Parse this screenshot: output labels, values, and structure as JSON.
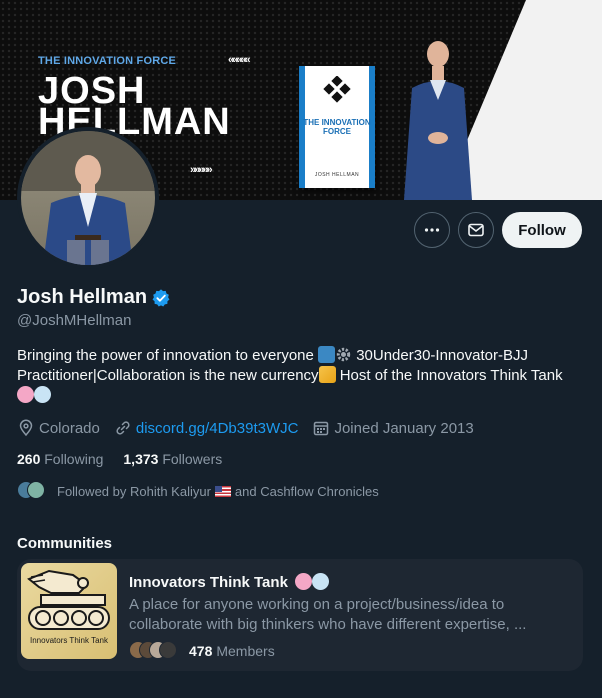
{
  "banner": {
    "kicker": "THE INNOVATION FORCE",
    "title_line1": "JOSH",
    "title_line2": "HELLMAN",
    "chevrons_top": "«««««",
    "chevrons_bottom": "»»»»»",
    "book_title": "THE INNOVATION FORCE",
    "book_author": "JOSH HELLMAN"
  },
  "actions": {
    "more_icon": "more-horizontal-icon",
    "message_icon": "envelope-icon",
    "follow_label": "Follow"
  },
  "profile": {
    "name": "Josh Hellman",
    "handle": "@JoshMHellman",
    "verified": true,
    "bio_part1": "Bringing the power of innovation to everyone ",
    "bio_part2": " 30Under30-Innovator-BJJ Practitioner|Collaboration is the new currency",
    "bio_part3": " Host of the Innovators Think Tank",
    "location": "Colorado",
    "website": "discord.gg/4Db39t3WJC",
    "joined": "Joined January 2013"
  },
  "stats": {
    "following_count": "260",
    "following_label": "Following",
    "followers_count": "1,373",
    "followers_label": "Followers"
  },
  "followed_by": {
    "prefix": "Followed by Rohith Kaliyur",
    "suffix": " and Cashflow Chronicles"
  },
  "communities": {
    "heading": "Communities",
    "items": [
      {
        "name": "Innovators Think Tank",
        "description": "A place for anyone working on a project/business/idea to collaborate with big thinkers who have different expertise, ...",
        "image_caption": "Innovators Think Tank",
        "member_count": "478",
        "member_label": "Members"
      }
    ]
  },
  "colors": {
    "background": "#15202b",
    "card": "#1e2732",
    "secondary_text": "#8b98a5",
    "link": "#1d9bf0",
    "verified": "#1d9bf0"
  }
}
